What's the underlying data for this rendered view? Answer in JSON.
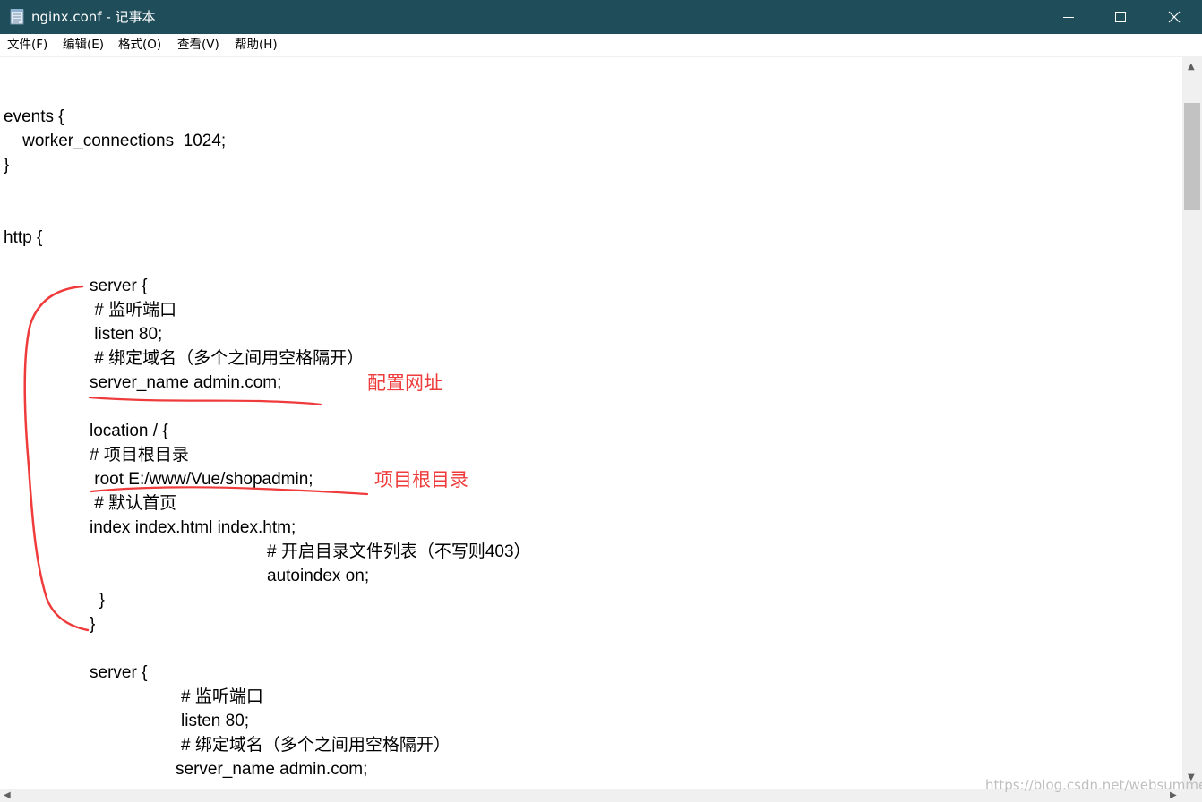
{
  "window": {
    "title": "nginx.conf - 记事本",
    "controls": [
      "minimize-icon",
      "maximize-icon",
      "close-icon"
    ]
  },
  "menu": {
    "items": [
      {
        "label": "文件(F)"
      },
      {
        "label": "编辑(E)"
      },
      {
        "label": "格式(O)"
      },
      {
        "label": "查看(V)"
      },
      {
        "label": "帮助(H)"
      }
    ]
  },
  "editor": {
    "lines": [
      {
        "text": "events {"
      },
      {
        "text": "    worker_connections  1024;"
      },
      {
        "text": "}"
      },
      {
        "text": "http {"
      },
      {
        "text": "server {"
      },
      {
        "text": " # 监听端口"
      },
      {
        "text": " listen 80;"
      },
      {
        "text": " # 绑定域名（多个之间用空格隔开）"
      },
      {
        "text": "server_name admin.com;"
      },
      {
        "text": "location / {"
      },
      {
        "text": "# 项目根目录"
      },
      {
        "text": " root E:/www/Vue/shopadmin;"
      },
      {
        "text": " # 默认首页"
      },
      {
        "text": "index index.html index.htm;"
      },
      {
        "text": "# 开启目录文件列表（不写则403）"
      },
      {
        "text": "autoindex on;"
      },
      {
        "text": "  }"
      },
      {
        "text": "}"
      },
      {
        "text": "server {"
      },
      {
        "text": "# 监听端口"
      },
      {
        "text": "listen 80;"
      },
      {
        "text": "# 绑定域名（多个之间用空格隔开）"
      },
      {
        "text": "server_name admin.com;"
      }
    ]
  },
  "annotations": {
    "site_label": "配置网址",
    "root_label": "项目根目录",
    "color": "#ef3b3b"
  },
  "watermark": "https://blog.csdn.net/websummer",
  "colors": {
    "titlebar": "#1f4e5a",
    "annotation": "#ef3b3b"
  }
}
